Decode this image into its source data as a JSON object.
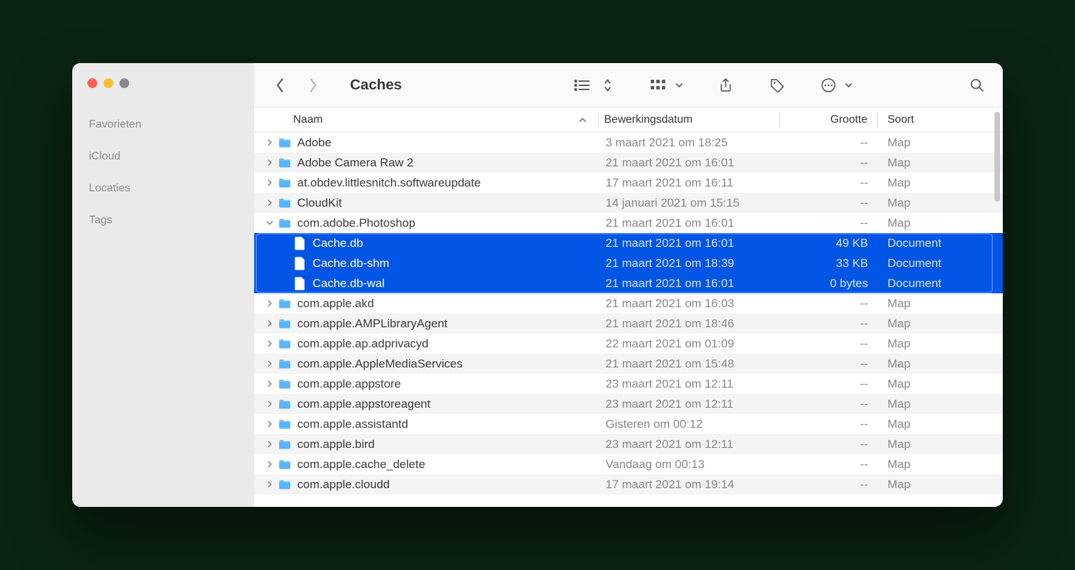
{
  "window": {
    "title": "Caches"
  },
  "sidebar": {
    "sections": [
      "Favorieten",
      "iCloud",
      "Locaties",
      "Tags"
    ]
  },
  "columns": {
    "name": "Naam",
    "date": "Bewerkingsdatum",
    "size": "Grootte",
    "kind": "Soort"
  },
  "rows": [
    {
      "indent": 0,
      "expandable": true,
      "open": false,
      "icon": "folder",
      "name": "Adobe",
      "date": "3 maart 2021 om 18:25",
      "size": "--",
      "kind": "Map",
      "selected": false
    },
    {
      "indent": 0,
      "expandable": true,
      "open": false,
      "icon": "folder",
      "name": "Adobe Camera Raw 2",
      "date": "21 maart 2021 om 16:01",
      "size": "--",
      "kind": "Map",
      "selected": false
    },
    {
      "indent": 0,
      "expandable": true,
      "open": false,
      "icon": "folder",
      "name": "at.obdev.littlesnitch.softwareupdate",
      "date": "17 maart 2021 om 16:11",
      "size": "--",
      "kind": "Map",
      "selected": false
    },
    {
      "indent": 0,
      "expandable": true,
      "open": false,
      "icon": "folder",
      "name": "CloudKit",
      "date": "14 januari 2021 om 15:15",
      "size": "--",
      "kind": "Map",
      "selected": false
    },
    {
      "indent": 0,
      "expandable": true,
      "open": true,
      "icon": "folder",
      "name": "com.adobe.Photoshop",
      "date": "21 maart 2021 om 16:01",
      "size": "--",
      "kind": "Map",
      "selected": false
    },
    {
      "indent": 1,
      "expandable": false,
      "open": false,
      "icon": "document",
      "name": "Cache.db",
      "date": "21 maart 2021 om 16:01",
      "size": "49 KB",
      "kind": "Document",
      "selected": true
    },
    {
      "indent": 1,
      "expandable": false,
      "open": false,
      "icon": "document",
      "name": "Cache.db-shm",
      "date": "21 maart 2021 om 18:39",
      "size": "33 KB",
      "kind": "Document",
      "selected": true
    },
    {
      "indent": 1,
      "expandable": false,
      "open": false,
      "icon": "document",
      "name": "Cache.db-wal",
      "date": "21 maart 2021 om 16:01",
      "size": "0 bytes",
      "kind": "Document",
      "selected": true
    },
    {
      "indent": 0,
      "expandable": true,
      "open": false,
      "icon": "folder",
      "name": "com.apple.akd",
      "date": "21 maart 2021 om 16:03",
      "size": "--",
      "kind": "Map",
      "selected": false
    },
    {
      "indent": 0,
      "expandable": true,
      "open": false,
      "icon": "folder",
      "name": "com.apple.AMPLibraryAgent",
      "date": "21 maart 2021 om 18:46",
      "size": "--",
      "kind": "Map",
      "selected": false
    },
    {
      "indent": 0,
      "expandable": true,
      "open": false,
      "icon": "folder",
      "name": "com.apple.ap.adprivacyd",
      "date": "22 maart 2021 om 01:09",
      "size": "--",
      "kind": "Map",
      "selected": false
    },
    {
      "indent": 0,
      "expandable": true,
      "open": false,
      "icon": "folder",
      "name": "com.apple.AppleMediaServices",
      "date": "21 maart 2021 om 15:48",
      "size": "--",
      "kind": "Map",
      "selected": false
    },
    {
      "indent": 0,
      "expandable": true,
      "open": false,
      "icon": "folder",
      "name": "com.apple.appstore",
      "date": "23 maart 2021 om 12:11",
      "size": "--",
      "kind": "Map",
      "selected": false
    },
    {
      "indent": 0,
      "expandable": true,
      "open": false,
      "icon": "folder",
      "name": "com.apple.appstoreagent",
      "date": "23 maart 2021 om 12:11",
      "size": "--",
      "kind": "Map",
      "selected": false
    },
    {
      "indent": 0,
      "expandable": true,
      "open": false,
      "icon": "folder",
      "name": "com.apple.assistantd",
      "date": "Gisteren om 00:12",
      "size": "--",
      "kind": "Map",
      "selected": false
    },
    {
      "indent": 0,
      "expandable": true,
      "open": false,
      "icon": "folder",
      "name": "com.apple.bird",
      "date": "23 maart 2021 om 12:11",
      "size": "--",
      "kind": "Map",
      "selected": false
    },
    {
      "indent": 0,
      "expandable": true,
      "open": false,
      "icon": "folder",
      "name": "com.apple.cache_delete",
      "date": "Vandaag om 00:13",
      "size": "--",
      "kind": "Map",
      "selected": false
    },
    {
      "indent": 0,
      "expandable": true,
      "open": false,
      "icon": "folder",
      "name": "com.apple.cloudd",
      "date": "17 maart 2021 om 19:14",
      "size": "--",
      "kind": "Map",
      "selected": false
    }
  ]
}
